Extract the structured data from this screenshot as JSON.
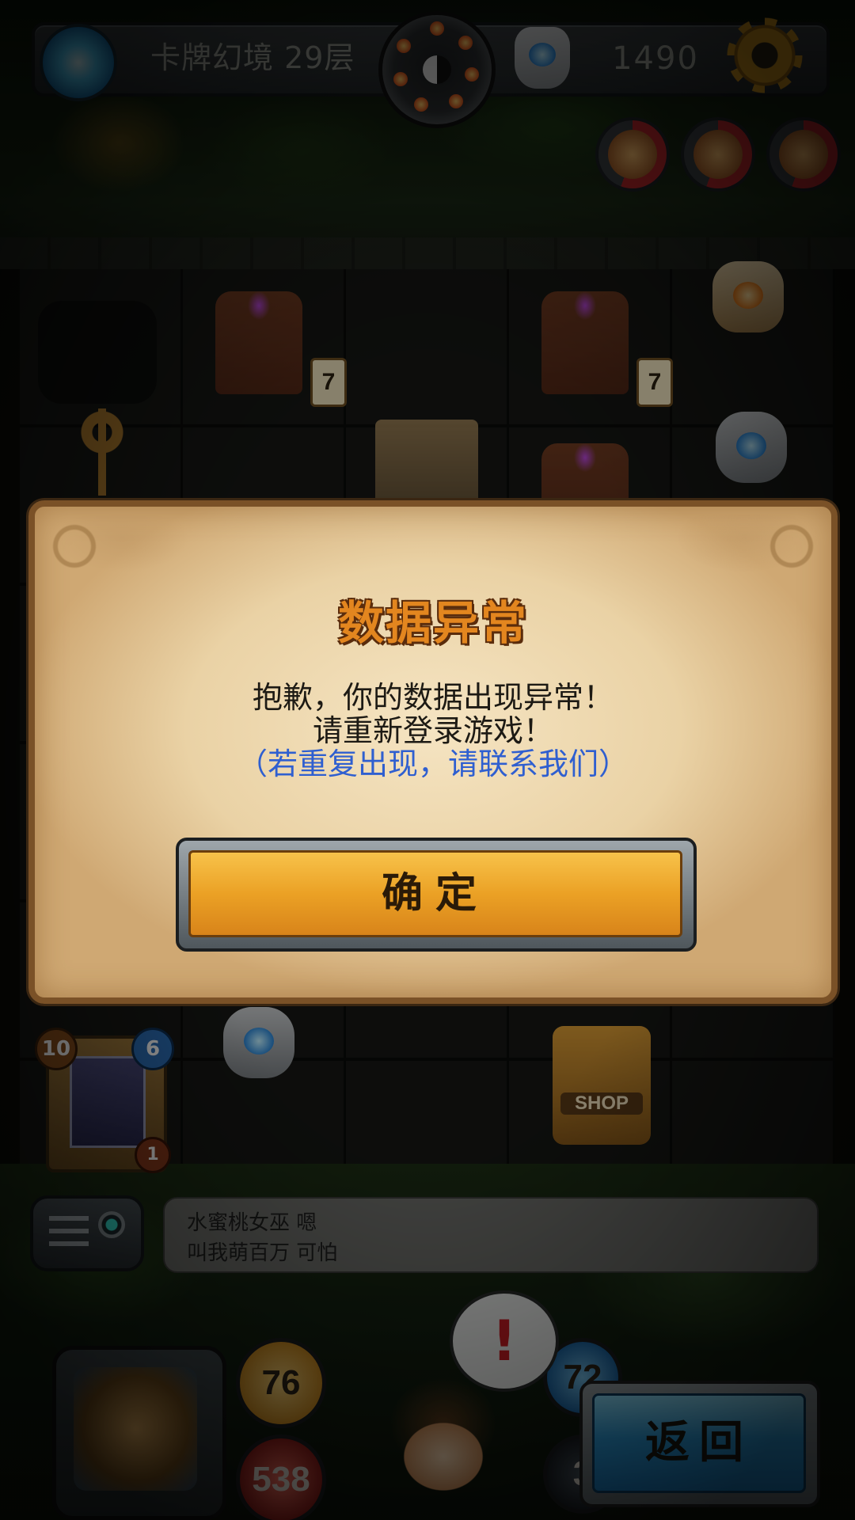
{
  "hud": {
    "floor_label": "卡牌幻境 29层",
    "coins": "1490",
    "icons": [
      "portal-icon",
      "medallion-icon",
      "stone-icon",
      "gear-icon"
    ],
    "status_icons": [
      "hammer-status-icon",
      "mask-status-icon",
      "hero-status-icon"
    ]
  },
  "board": {
    "totem_counters": [
      "7",
      "7"
    ],
    "deck": {
      "left_count": "10",
      "right_count": "6",
      "bottom_count": "1"
    },
    "shop_label": "SHOP"
  },
  "chat": {
    "lines": [
      "水蜜桃女巫 嗯",
      "叫我萌百万 可怕"
    ]
  },
  "bottom": {
    "attack": "76",
    "hp": "538",
    "shield": "72",
    "extra": "3",
    "alert": "!",
    "back_label": "返回"
  },
  "dialog": {
    "title": "数据异常",
    "message_line1": "抱歉，你的数据出现异常！",
    "message_line2": "请重新登录游戏！",
    "message_line3": "（若重复出现，请联系我们）",
    "confirm_label": "确定"
  },
  "colors": {
    "dialog_title": "#e3861f",
    "dialog_link": "#2f5fd0",
    "confirm_button": "#eba125",
    "back_button": "#2e9fde"
  }
}
